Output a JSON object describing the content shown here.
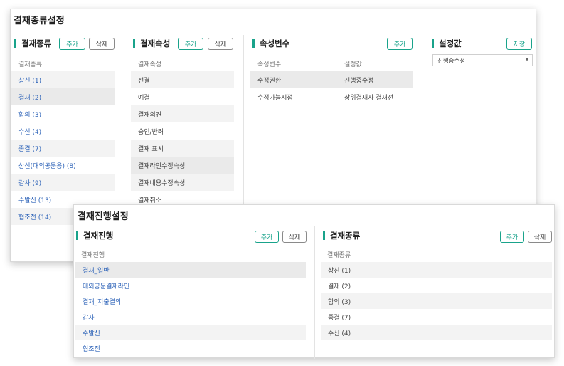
{
  "panel1": {
    "title": "결재종류설정",
    "sec1": {
      "title": "결재종류",
      "add": "추가",
      "delete": "삭제",
      "column": "결재종류",
      "items": [
        "상신 (1)",
        "결재 (2)",
        "합의 (3)",
        "수신 (4)",
        "종결 (7)",
        "상신(대외공문용) (8)",
        "감사 (9)",
        "수발신 (13)",
        "협조전 (14)"
      ]
    },
    "sec2": {
      "title": "결재속성",
      "add": "추가",
      "delete": "삭제",
      "column": "결재속성",
      "items": [
        "전결",
        "예결",
        "결재의견",
        "승인/반려",
        "결재 표시",
        "결재라인수정속성",
        "결재내용수정속성",
        "결재취소"
      ]
    },
    "sec3": {
      "title": "속성변수",
      "add": "추가",
      "columns": [
        "속성변수",
        "설정값"
      ],
      "rows": [
        [
          "수정권한",
          "진행중수정"
        ],
        [
          "수정가능시점",
          "상위결재자 결재전"
        ]
      ]
    },
    "sec4": {
      "title": "설정값",
      "save": "저장",
      "select_value": "진행중수정"
    }
  },
  "panel2": {
    "title": "결재진행설정",
    "sec1": {
      "title": "결재진행",
      "add": "추가",
      "delete": "삭제",
      "column": "결재진행",
      "items": [
        "결재_일반",
        "대외공문결재라인",
        "결재_지출결의",
        "감사",
        "수발신",
        "협조전"
      ]
    },
    "sec2": {
      "title": "결재종류",
      "add": "추가",
      "delete": "삭제",
      "column": "결재종류",
      "items": [
        "상신 (1)",
        "결재 (2)",
        "합의 (3)",
        "종결 (7)",
        "수신 (4)"
      ]
    }
  }
}
